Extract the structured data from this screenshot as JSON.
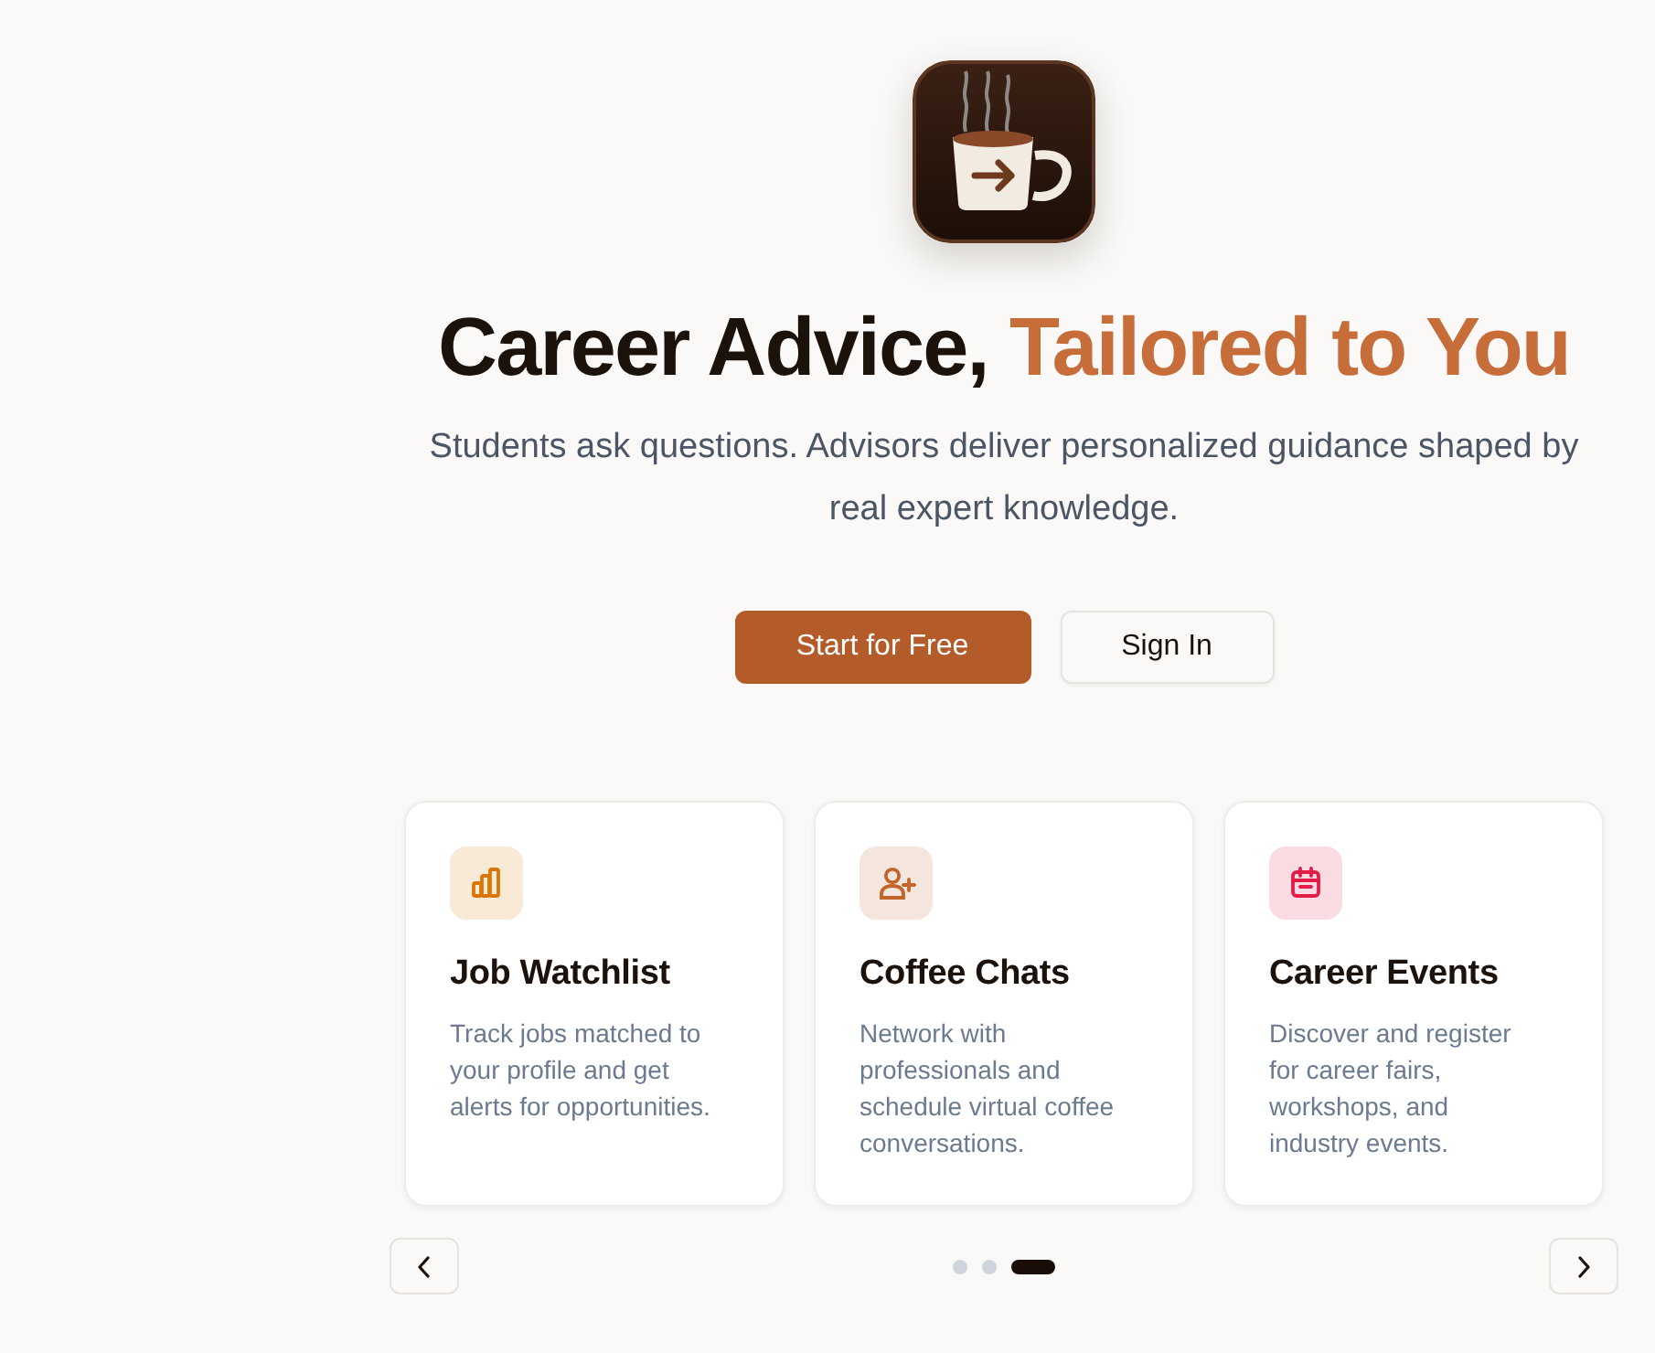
{
  "hero": {
    "title": "Career Advice,",
    "title_highlight": "Tailored to You",
    "subtitle": "Students ask questions. Advisors deliver personalized guidance shaped by real expert knowledge."
  },
  "actions": [
    {
      "label": "Start for Free",
      "kind": "primary"
    },
    {
      "label": "Sign In",
      "kind": "secondary"
    }
  ],
  "features": [
    {
      "title": "Job Watchlist",
      "description": "Track jobs matched to your profile and get alerts for opportunities.",
      "color": "#d97706"
    },
    {
      "title": "Coffee Chats",
      "description": "Network with professionals and schedule virtual coffee conversations.",
      "color": "#c2652a"
    },
    {
      "title": "Career Events",
      "description": "Discover and register for career fairs, workshops, and industry events.",
      "color": "#e11d48"
    }
  ],
  "carousel": {
    "dots": [
      {
        "selected": false
      },
      {
        "selected": false
      },
      {
        "selected": true
      }
    ]
  }
}
